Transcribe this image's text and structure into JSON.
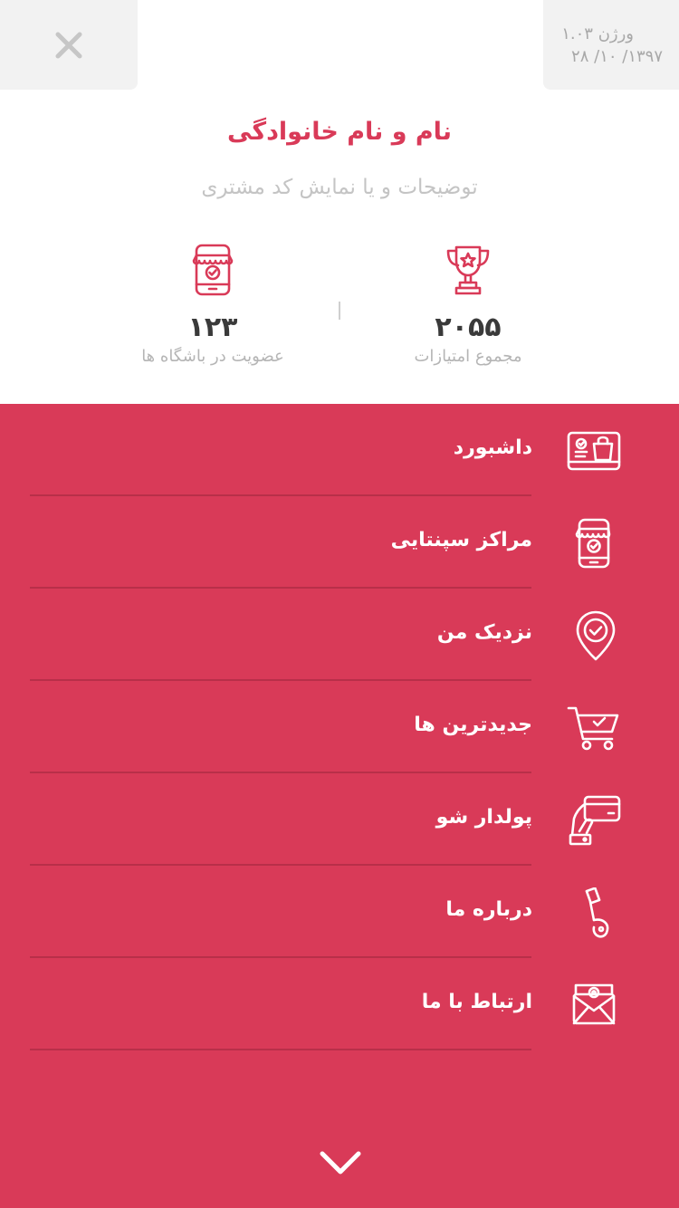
{
  "header": {
    "version_line": "ورژن   ۱.۰۳",
    "date_line": "۱۳۹۷/ ۱۰/ ۲۸"
  },
  "profile": {
    "name": "نام و نام خانوادگی",
    "description": "توضیحات و یا نمایش کد مشتری"
  },
  "stats": {
    "points": {
      "value": "۲۰۵۵",
      "label": "مجموع امتیازات",
      "icon": "trophy-icon"
    },
    "memberships": {
      "value": "۱۲۳",
      "label": "عضویت در باشگاه ها",
      "icon": "mobile-shop-icon"
    }
  },
  "menu": {
    "items": [
      {
        "label": "داشبورد",
        "icon": "dashboard-icon"
      },
      {
        "label": "مراکز سپنتایی",
        "icon": "mobile-shop-icon"
      },
      {
        "label": "نزدیک من",
        "icon": "location-pin-icon"
      },
      {
        "label": "جدیدترین ها",
        "icon": "cart-icon"
      },
      {
        "label": "پولدار شو",
        "icon": "card-hand-icon"
      },
      {
        "label": "درباره ما",
        "icon": "info-icon"
      },
      {
        "label": "ارتباط با ما",
        "icon": "mail-icon"
      }
    ]
  },
  "colors": {
    "accent": "#d93a58",
    "menu_background": "#d93a58",
    "divider": "#b82f49",
    "header_box": "#f2f2f2"
  }
}
